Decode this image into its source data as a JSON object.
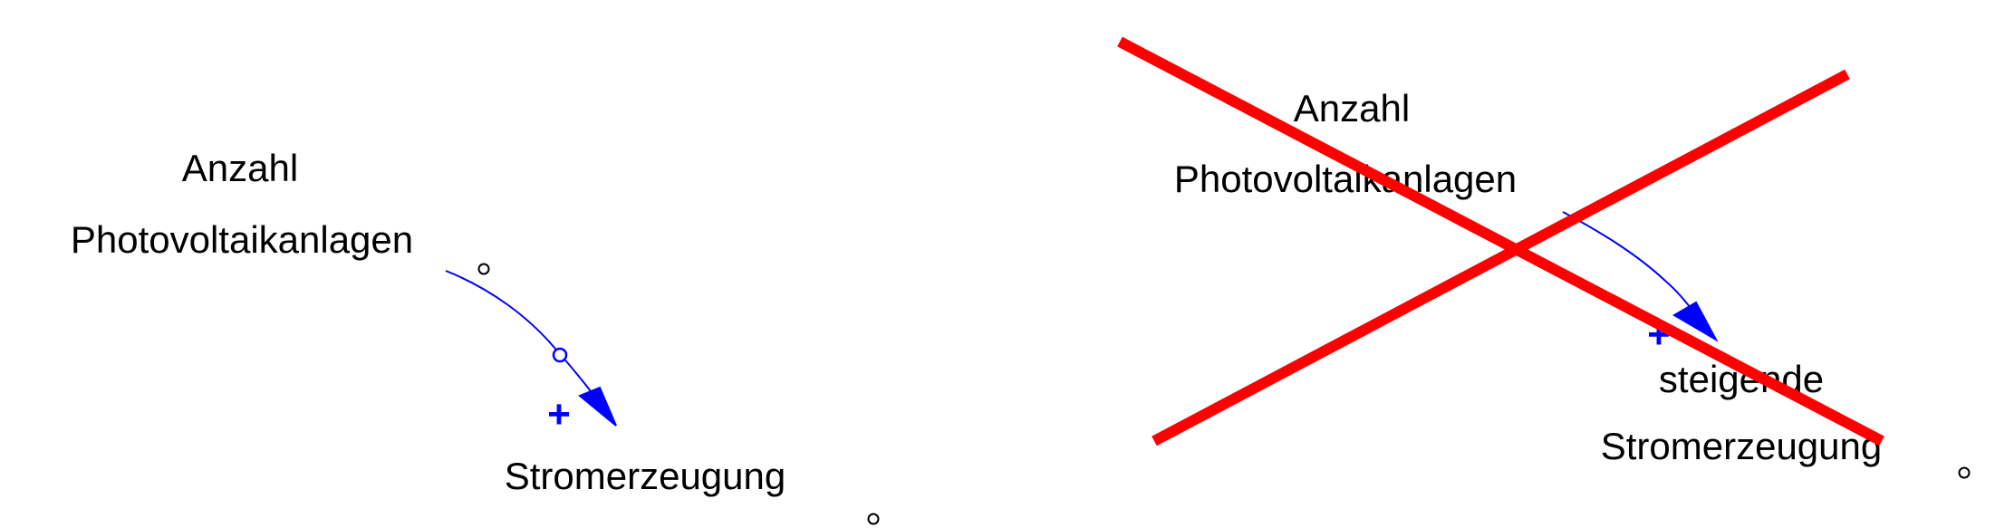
{
  "diagram_left": {
    "source_node": {
      "line1": "Anzahl",
      "line2": "Photovoltaikanlagen"
    },
    "target_node": {
      "line1": "Stromerzeugung"
    },
    "link": {
      "polarity": "+",
      "color": "#0000ff"
    }
  },
  "diagram_right": {
    "source_node": {
      "line1": "Anzahl",
      "line2": "Photovoltaikanlagen"
    },
    "target_node": {
      "line1": "steigende",
      "line2": "Stromerzeugung"
    },
    "link": {
      "polarity": "+",
      "color": "#0000ff"
    },
    "cross_out": {
      "color": "#ff0000"
    }
  }
}
